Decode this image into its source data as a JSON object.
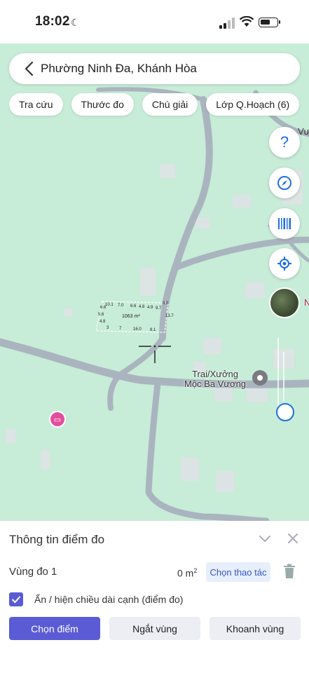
{
  "status": {
    "time": "18:02"
  },
  "search": {
    "location": "Phường Ninh Đa, Khánh Hòa"
  },
  "chips": [
    "Tra cứu",
    "Thước đo",
    "Chú giải",
    "Lớp Q.Hoạch (6)"
  ],
  "map": {
    "poi_label_line1": "Trai/Xưởng",
    "poi_label_line2": "Mộc Ba Vương",
    "partial_right_label": "Vư",
    "partial_n": "N",
    "parcel_area": "1063 m²",
    "parcel_edges": [
      "10.1",
      "7.0",
      "6.6",
      "4.8",
      "4.9",
      "9.7",
      "6.6",
      "13.7",
      "8.1",
      "16.0",
      "7",
      "3",
      "4.8",
      "5.6",
      "6.6"
    ]
  },
  "fabs": [
    "help-icon",
    "compass-icon",
    "barcode-icon",
    "locate-icon"
  ],
  "panel": {
    "title": "Thông tin điểm đo",
    "region_label": "Vùng đo 1",
    "region_value": "0 m",
    "region_unit_sup": "2",
    "action_label": "Chọn thao tác",
    "checkbox_label": "Ẩn / hiện chiều dài cạnh (điểm đo)",
    "buttons": {
      "pick_point": "Chọn điểm",
      "break_region": "Ngắt vùng",
      "enclose_region": "Khoanh vùng"
    }
  },
  "colors": {
    "map_bg": "#c7ecd7",
    "road": "#aab4bf",
    "accent": "#5b5bd6",
    "hotel_pin": "#e24e9e"
  }
}
